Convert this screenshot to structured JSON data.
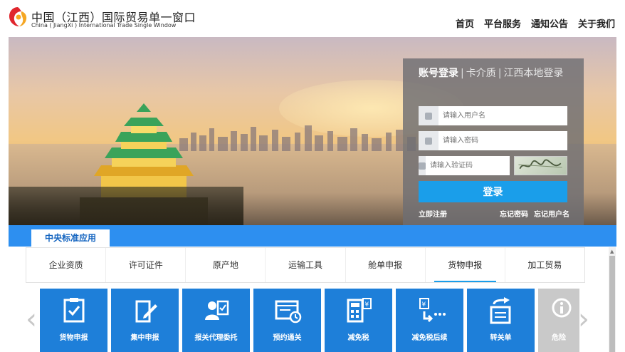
{
  "header": {
    "title_cn": "中国（江西）国际贸易单一窗口",
    "title_en": "China ( JiangXi ) International Trade Single Window",
    "nav": [
      "首页",
      "平台服务",
      "通知公告",
      "关于我们"
    ]
  },
  "login": {
    "tab_account": "账号登录",
    "tab_card": "卡介质",
    "tab_local": "江西本地登录",
    "username_placeholder": "请输入用户名",
    "password_placeholder": "请输入密码",
    "captcha_placeholder": "请输入验证码",
    "login_button": "登录",
    "register_link": "立即注册",
    "forgot_password": "忘记密码",
    "forgot_username": "忘记用户名"
  },
  "section": {
    "title": "中央标准应用"
  },
  "subtabs": [
    "企业资质",
    "许可证件",
    "原产地",
    "运输工具",
    "舱单申报",
    "货物申报",
    "加工贸易"
  ],
  "tiles": [
    "货物申报",
    "集中申报",
    "报关代理委托",
    "预约通关",
    "减免税",
    "减免税后续",
    "转关单",
    "危险"
  ],
  "colors": {
    "primary_blue": "#2d8ff0",
    "tile_blue": "#1e7fd9",
    "button_blue": "#1a9eea"
  }
}
